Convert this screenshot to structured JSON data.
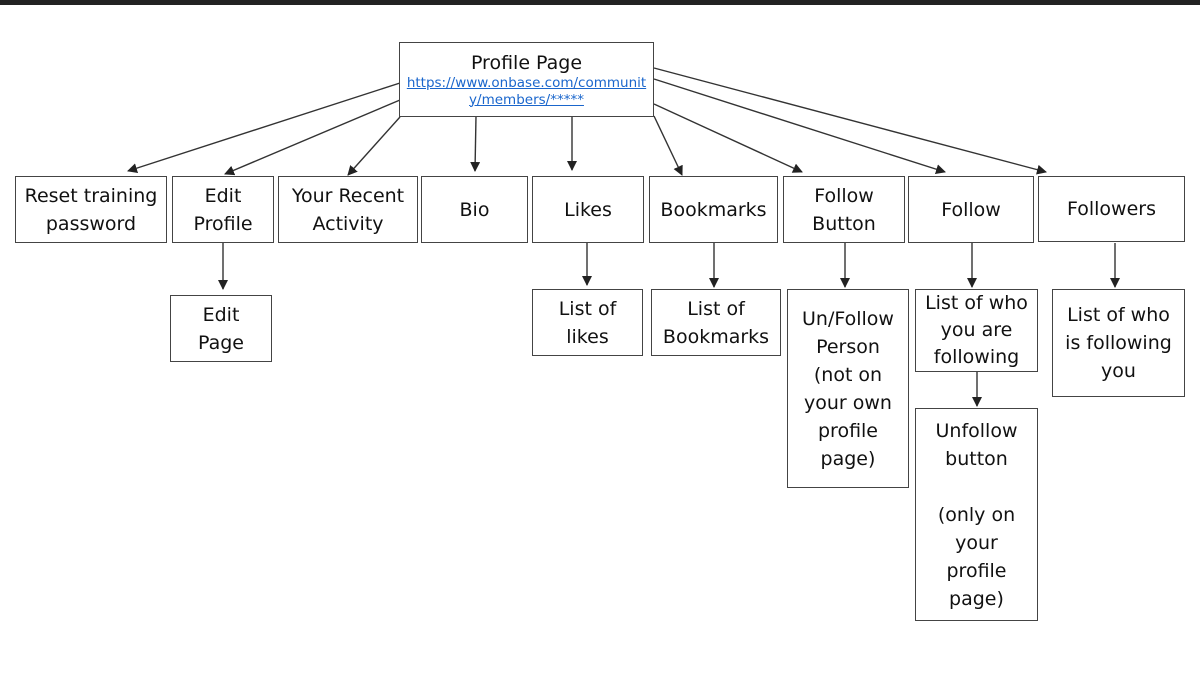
{
  "diagram": {
    "root": {
      "title": "Profile Page",
      "url": "https://www.onbase.com/community/members/*****",
      "link_color": "#1a66cc"
    },
    "level1": [
      {
        "id": "reset",
        "label": "Reset training\npassword"
      },
      {
        "id": "edit-profile",
        "label": "Edit\nProfile"
      },
      {
        "id": "recent-activity",
        "label": "Your Recent\nActivity"
      },
      {
        "id": "bio",
        "label": "Bio"
      },
      {
        "id": "likes",
        "label": "Likes"
      },
      {
        "id": "bookmarks",
        "label": "Bookmarks"
      },
      {
        "id": "follow-button",
        "label": "Follow\nButton"
      },
      {
        "id": "follow",
        "label": "Follow"
      },
      {
        "id": "followers",
        "label": "Followers"
      }
    ],
    "level2": [
      {
        "id": "edit-page",
        "parent": "edit-profile",
        "label": "Edit\nPage"
      },
      {
        "id": "list-likes",
        "parent": "likes",
        "label": "List of\nlikes"
      },
      {
        "id": "list-bookmarks",
        "parent": "bookmarks",
        "label": "List of\nBookmarks"
      },
      {
        "id": "unfollow-person",
        "parent": "follow-button",
        "label": "Un/Follow\nPerson\n(not on\nyour own\nprofile\npage)"
      },
      {
        "id": "list-following",
        "parent": "follow",
        "label": "List of who\nyou are\nfollowing"
      },
      {
        "id": "list-followers",
        "parent": "followers",
        "label": "List of who\nis following\nyou"
      }
    ],
    "level3": [
      {
        "id": "unfollow-button",
        "parent": "list-following",
        "label": "Unfollow\nbutton\n\n(only on\nyour\nprofile\npage)"
      }
    ]
  }
}
